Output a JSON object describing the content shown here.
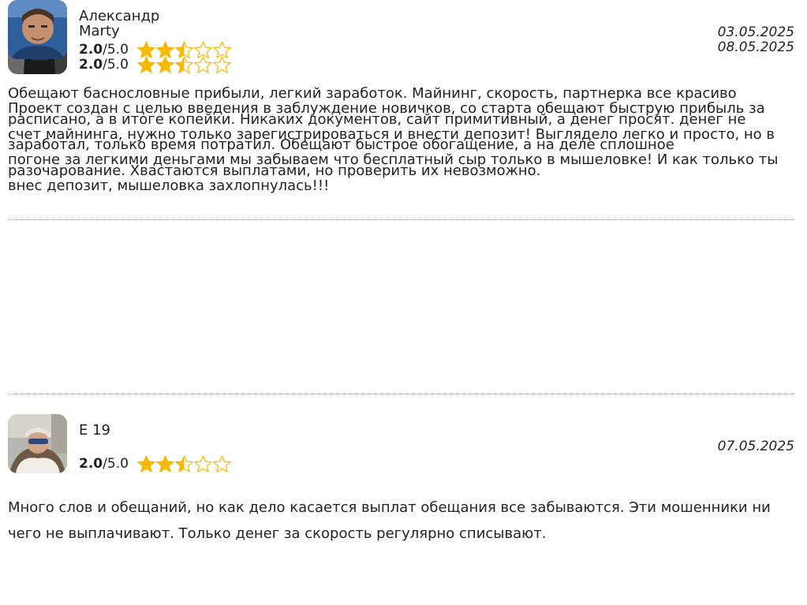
{
  "reviews": [
    {
      "author": "Marty",
      "score": "2.0",
      "max": "/5.0",
      "stars_filled": 2.5,
      "stars_total": 5,
      "date": "08.05.2025",
      "text": "Проект создан с целью введения в заблуждение новичков, со старта обещают быструю прибыль за счет майнинга, нужно только зарегистрироваться и внести депозит! Выглядело легко и просто, но в погоне за легкими деньгами мы забываем что бесплатный сыр только в мышеловке! И как только ты внес депозит, мышеловка захлопнулась!!!"
    },
    {
      "author": "E 19",
      "score": "2.0",
      "max": "/5.0",
      "stars_filled": 2.5,
      "stars_total": 5,
      "date": "07.05.2025",
      "text": "Много слов и обещаний, но как дело касается выплат обещания все забываются. Эти мошенники ни чего не выплачивают. Только денег за скорость регулярно списывают."
    },
    {
      "author": "Александр",
      "score": "2.0",
      "max": "/5.0",
      "stars_filled": 2.5,
      "stars_total": 5,
      "date": "03.05.2025",
      "text": "Обещают баснословные прибыли, легкий заработок. Майнинг, скорость, партнерка все красиво расписано, а в итоге копейки. Никаких документов, сайт примитивный, а денег просят. денег не заработал, только время потратил. Обещают быстрое обогащение, а на деле сплошное разочарование. Хвастаются выплатами, но проверить их невозможно."
    }
  ],
  "colors": {
    "star": "#F5B90A",
    "star_outline": "#F5B90A",
    "separator": "#999999",
    "text": "#222222"
  },
  "icons": {
    "avatar": "user-photo",
    "star_full": "star-filled-icon",
    "star_half": "star-half-icon",
    "star_empty": "star-empty-icon"
  }
}
